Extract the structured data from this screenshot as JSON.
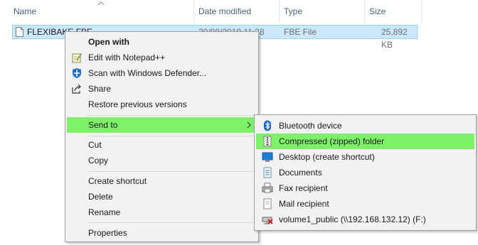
{
  "columns": {
    "name": "Name",
    "date_modified": "Date modified",
    "type": "Type",
    "size": "Size"
  },
  "file": {
    "name": "FLEXIBAKE.FBE",
    "date_modified": "20/08/2019 11:38",
    "type": "FBE File",
    "size": "25,892 KB"
  },
  "context_menu": {
    "items": [
      {
        "label": "Open with",
        "icon": "none"
      },
      {
        "label": "Edit with Notepad++",
        "icon": "notepad-plus-plus-icon"
      },
      {
        "label": "Scan with Windows Defender...",
        "icon": "windows-defender-icon"
      },
      {
        "label": "Share",
        "icon": "share-icon"
      },
      {
        "label": "Restore previous versions",
        "icon": "none"
      },
      {
        "label": "Send to",
        "icon": "none"
      },
      {
        "label": "Cut",
        "icon": "none"
      },
      {
        "label": "Copy",
        "icon": "none"
      },
      {
        "label": "Create shortcut",
        "icon": "none"
      },
      {
        "label": "Delete",
        "icon": "none"
      },
      {
        "label": "Rename",
        "icon": "none"
      },
      {
        "label": "Properties",
        "icon": "none"
      }
    ]
  },
  "send_to_menu": {
    "items": [
      {
        "label": "Bluetooth device",
        "icon": "bluetooth-icon"
      },
      {
        "label": "Compressed (zipped) folder",
        "icon": "zip-folder-icon"
      },
      {
        "label": "Desktop (create shortcut)",
        "icon": "desktop-icon"
      },
      {
        "label": "Documents",
        "icon": "documents-icon"
      },
      {
        "label": "Fax recipient",
        "icon": "fax-icon"
      },
      {
        "label": "Mail recipient",
        "icon": "mail-icon"
      },
      {
        "label": "volume1_public (\\\\192.168.132.12) (F:)",
        "icon": "network-drive-icon"
      }
    ]
  },
  "colors": {
    "highlight": "#7ef06a",
    "selection": "#cce8ff",
    "menu_bg": "#f2f2f2",
    "header_text": "#4c607a"
  }
}
